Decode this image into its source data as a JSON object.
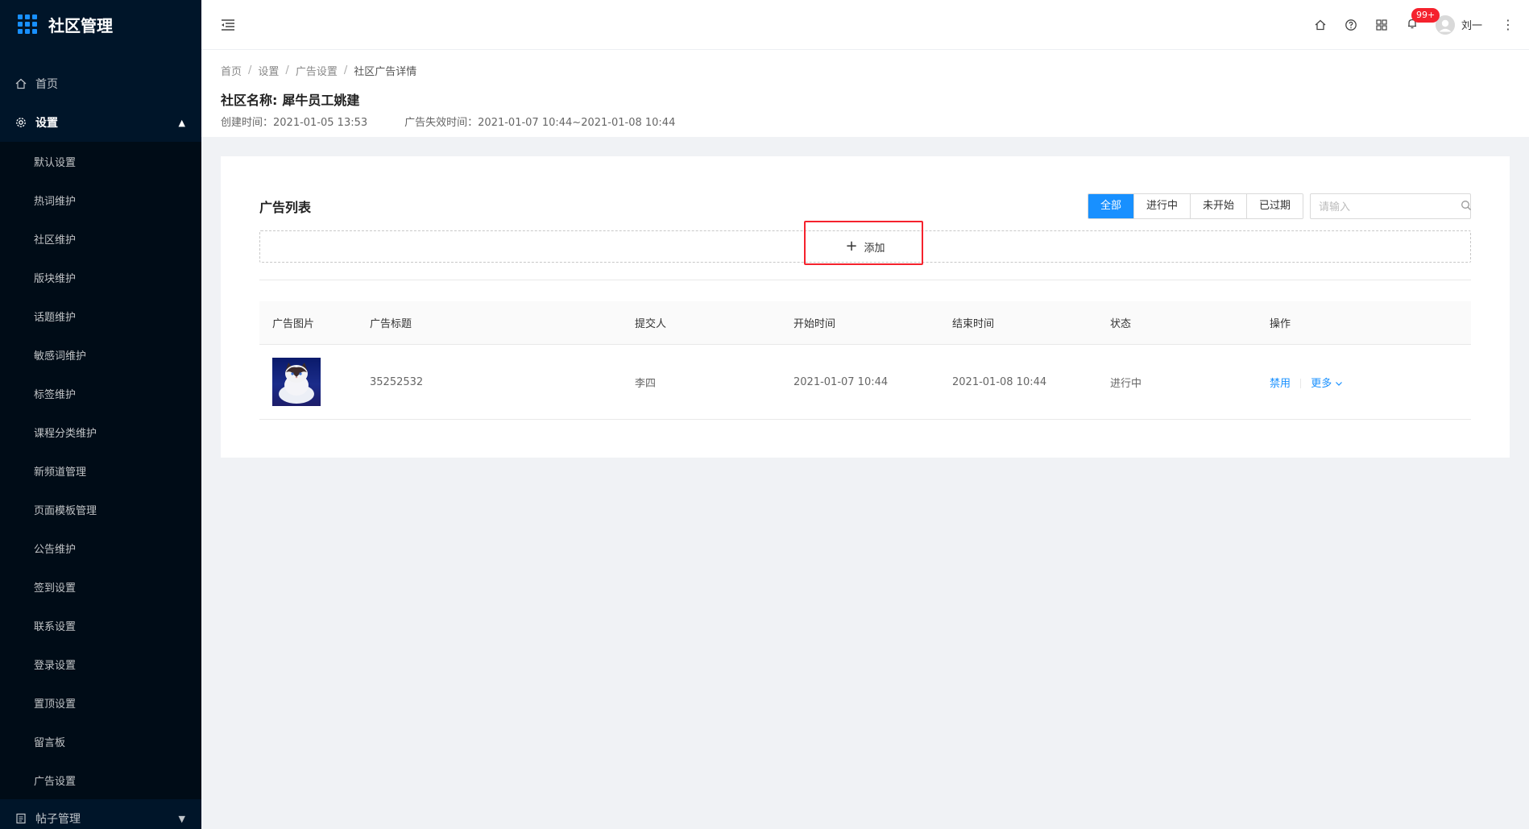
{
  "app": {
    "title": "社区管理"
  },
  "sidebar": {
    "items": [
      {
        "label": "首页",
        "icon": "home-icon"
      },
      {
        "label": "设置",
        "icon": "gear-icon",
        "open": true
      },
      {
        "label": "帖子管理",
        "icon": "document-icon"
      }
    ],
    "submenu": [
      "默认设置",
      "热词维护",
      "社区维护",
      "版块维护",
      "话题维护",
      "敏感词维护",
      "标签维护",
      "课程分类维护",
      "新频道管理",
      "页面模板管理",
      "公告维护",
      "签到设置",
      "联系设置",
      "登录设置",
      "置顶设置",
      "留言板",
      "广告设置"
    ]
  },
  "header": {
    "notification_badge": "99+",
    "user_name": "刘一"
  },
  "breadcrumb": [
    "首页",
    "设置",
    "广告设置",
    "社区广告详情"
  ],
  "page": {
    "title_label": "社区名称:",
    "title_value": "犀牛员工姚建",
    "created": "创建时间：2021-01-05 13:53",
    "expire": "广告失效时间：2021-01-07 10:44~2021-01-08 10:44"
  },
  "card": {
    "title": "广告列表",
    "filters": [
      "全部",
      "进行中",
      "未开始",
      "已过期"
    ],
    "active_filter": "全部",
    "search_placeholder": "请输入",
    "add_label": "添加"
  },
  "table": {
    "columns": [
      "广告图片",
      "广告标题",
      "提交人",
      "开始时间",
      "结束时间",
      "状态",
      "操作"
    ],
    "rows": [
      {
        "title": "35252532",
        "submitter": "李四",
        "start": "2021-01-07 10:44",
        "end": "2021-01-08 10:44",
        "status": "进行中",
        "action_disable": "禁用",
        "action_more": "更多"
      }
    ]
  },
  "colors": {
    "primary": "#1890ff",
    "sidebar_bg": "#001529",
    "highlight": "#f5222d"
  }
}
